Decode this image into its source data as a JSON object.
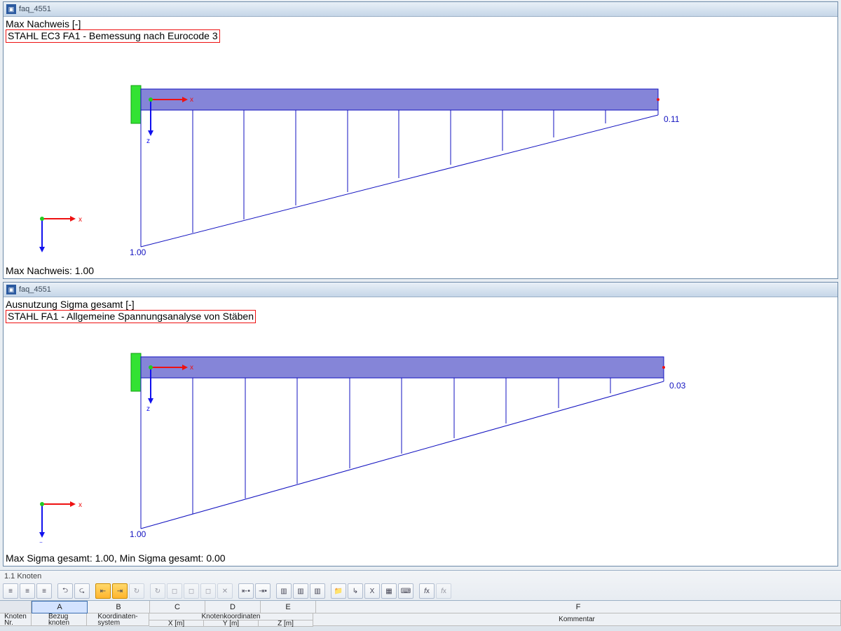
{
  "panels": [
    {
      "title": "faq_4551",
      "sub": "Max Nachweis [-]",
      "boxed": "STAHL EC3 FA1 - Bemessung nach Eurocode 3",
      "right_val": "0.11",
      "left_val": "1.00",
      "summary": "Max Nachweis: 1.00"
    },
    {
      "title": "faq_4551",
      "sub": "Ausnutzung Sigma gesamt [-]",
      "boxed": "STAHL FA1 - Allgemeine Spannungsanalyse von Stäben",
      "right_val": "0.03",
      "left_val": "1.00",
      "summary": "Max Sigma gesamt: 1.00, Min Sigma gesamt: 0.00"
    }
  ],
  "axes": {
    "x": "x",
    "z": "z"
  },
  "grid": {
    "caption": "1.1 Knoten",
    "toolbar": [
      "≡",
      "≡",
      "≡",
      "⮌",
      "⮎",
      "⇤",
      "⇥",
      "↻",
      "↻",
      "◻",
      "◻",
      "◻",
      "✕",
      "⇤•",
      "⇥•",
      "▥",
      "▥",
      "▥",
      "📁",
      "↳",
      "X",
      "▦",
      "⌨",
      "fx",
      "fx"
    ],
    "cols": {
      "letters": [
        "A",
        "B",
        "C",
        "D",
        "E",
        "F"
      ]
    },
    "headers": {
      "rownum": "Knoten\nNr.",
      "A": "Bezug\nknoten",
      "B": "Koordinaten-\nsystem",
      "C_top": "Knotenkoordinaten",
      "C": "X [m]",
      "D": "Y [m]",
      "E": "Z [m]",
      "F": "Kommentar"
    }
  }
}
